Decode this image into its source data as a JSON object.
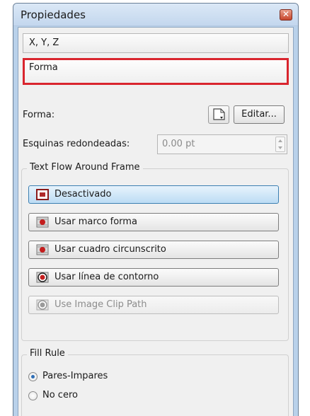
{
  "window": {
    "title": "Propiedades",
    "close_icon": "close-icon"
  },
  "sections": {
    "xyz_label": "X, Y, Z",
    "shape_label": "Forma"
  },
  "shape_row": {
    "label": "Forma:",
    "shape_icon": "shape-picker-icon",
    "edit_label": "Editar..."
  },
  "rounded_corners": {
    "label": "Esquinas redondeadas:",
    "value": "0.00 pt"
  },
  "text_flow": {
    "legend": "Text Flow Around Frame",
    "options": [
      {
        "label": "Desactivado",
        "icon": "flow-off-icon",
        "state": "active"
      },
      {
        "label": "Usar marco forma",
        "icon": "flow-frame-shape-icon",
        "state": "normal"
      },
      {
        "label": "Usar cuadro circunscrito",
        "icon": "flow-bounding-box-icon",
        "state": "normal"
      },
      {
        "label": "Usar línea de contorno",
        "icon": "flow-contour-line-icon",
        "state": "normal"
      },
      {
        "label": "Use Image Clip Path",
        "icon": "flow-clip-path-icon",
        "state": "disabled"
      }
    ]
  },
  "fill_rule": {
    "legend": "Fill Rule",
    "options": [
      {
        "label": "Pares-Impares",
        "checked": true
      },
      {
        "label": "No cero",
        "checked": false
      }
    ]
  },
  "colors": {
    "highlight": "#d9252e",
    "active_button": "#bcdcf4",
    "window_frame": "#b9d1ea"
  }
}
